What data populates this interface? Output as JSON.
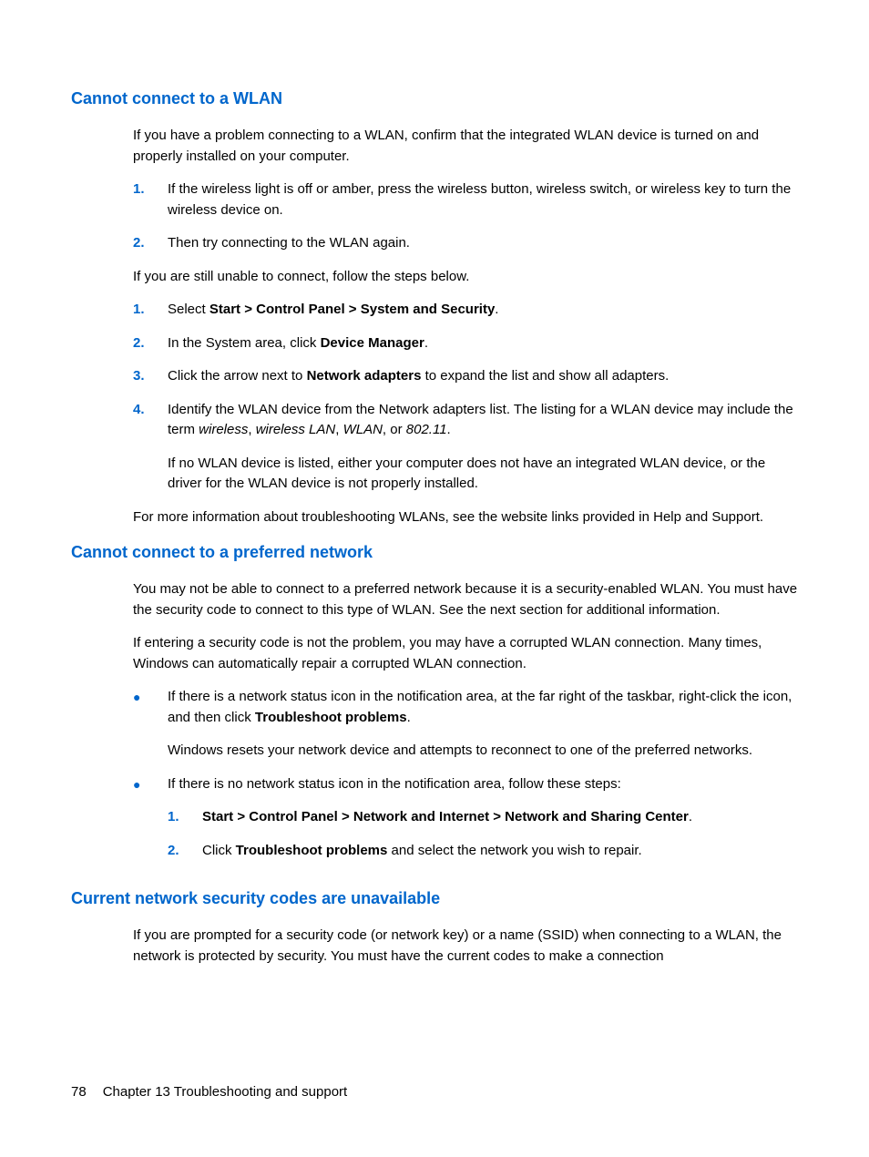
{
  "section1": {
    "heading": "Cannot connect to a WLAN",
    "p1": "If you have a problem connecting to a WLAN, confirm that the integrated WLAN device is turned on and properly installed on your computer.",
    "list1": {
      "n1": "1.",
      "t1": "If the wireless light is off or amber, press the wireless button, wireless switch, or wireless key to turn the wireless device on.",
      "n2": "2.",
      "t2": "Then try connecting to the WLAN again."
    },
    "p2": "If you are still unable to connect, follow the steps below.",
    "list2": {
      "n1": "1.",
      "t1a": "Select ",
      "t1b": "Start > Control Panel > System and Security",
      "t1c": ".",
      "n2": "2.",
      "t2a": "In the System area, click ",
      "t2b": "Device Manager",
      "t2c": ".",
      "n3": "3.",
      "t3a": "Click the arrow next to ",
      "t3b": "Network adapters",
      "t3c": " to expand the list and show all adapters.",
      "n4": "4.",
      "t4a": "Identify the WLAN device from the Network adapters list. The listing for a WLAN device may include the term ",
      "t4b": "wireless",
      "t4c": ", ",
      "t4d": "wireless LAN",
      "t4e": ", ",
      "t4f": "WLAN",
      "t4g": ", or ",
      "t4h": "802.11",
      "t4i": ".",
      "t4p2": "If no WLAN device is listed, either your computer does not have an integrated WLAN device, or the driver for the WLAN device is not properly installed."
    },
    "p3": "For more information about troubleshooting WLANs, see the website links provided in Help and Support."
  },
  "section2": {
    "heading": "Cannot connect to a preferred network",
    "p1": "You may not be able to connect to a preferred network because it is a security-enabled WLAN. You must have the security code to connect to this type of WLAN. See the next section for additional information.",
    "p2": "If entering a security code is not the problem, you may have a corrupted WLAN connection. Many times, Windows can automatically repair a corrupted WLAN connection.",
    "bullet1": {
      "t1a": "If there is a network status icon in the notification area, at the far right of the taskbar, right-click the icon, and then click ",
      "t1b": "Troubleshoot problems",
      "t1c": ".",
      "t1p2": "Windows resets your network device and attempts to reconnect to one of the preferred networks."
    },
    "bullet2": {
      "t1": "If there is no network status icon in the notification area, follow these steps:",
      "nested": {
        "n1": "1.",
        "t1a": "Start > Control Panel > Network and Internet > Network and Sharing Center",
        "t1b": ".",
        "n2": "2.",
        "t2a": "Click ",
        "t2b": "Troubleshoot problems",
        "t2c": " and select the network you wish to repair."
      }
    }
  },
  "section3": {
    "heading": "Current network security codes are unavailable",
    "p1": "If you are prompted for a security code (or network key) or a name (SSID) when connecting to a WLAN, the network is protected by security. You must have the current codes to make a connection"
  },
  "footer": {
    "page": "78",
    "chapter": "Chapter 13   Troubleshooting and support"
  },
  "bullet_char": "●"
}
